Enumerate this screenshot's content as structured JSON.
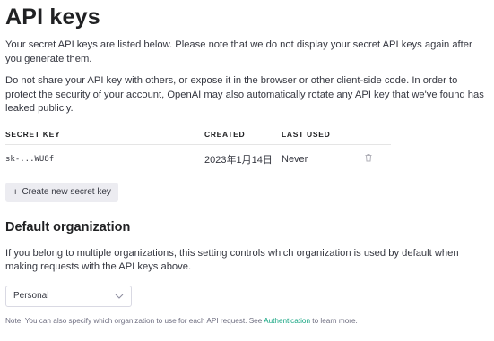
{
  "page": {
    "title": "API keys",
    "intro": "Your secret API keys are listed below. Please note that we do not display your secret API keys again after you generate them.",
    "warning": "Do not share your API key with others, or expose it in the browser or other client-side code. In order to protect the security of your account, OpenAI may also automatically rotate any API key that we've found has leaked publicly."
  },
  "keys_table": {
    "headers": {
      "secret_key": "SECRET KEY",
      "created": "CREATED",
      "last_used": "LAST USED"
    },
    "rows": [
      {
        "secret_key": "sk-...WU8f",
        "created": "2023年1月14日",
        "last_used": "Never",
        "action_icon": "trash-icon"
      }
    ]
  },
  "create_button": {
    "icon": "plus-icon",
    "label": "Create new secret key"
  },
  "default_org": {
    "heading": "Default organization",
    "description": "If you belong to multiple organizations, this setting controls which organization is used by default when making requests with the API keys above.",
    "selected": "Personal",
    "select_icon": "chevron-down-icon"
  },
  "note": {
    "prefix": "Note: You can also specify which organization to use for each API request. See ",
    "link": "Authentication",
    "suffix": " to learn more."
  },
  "colors": {
    "link": "#10a37f",
    "text": "#202123",
    "button_bg": "#ececf1"
  }
}
